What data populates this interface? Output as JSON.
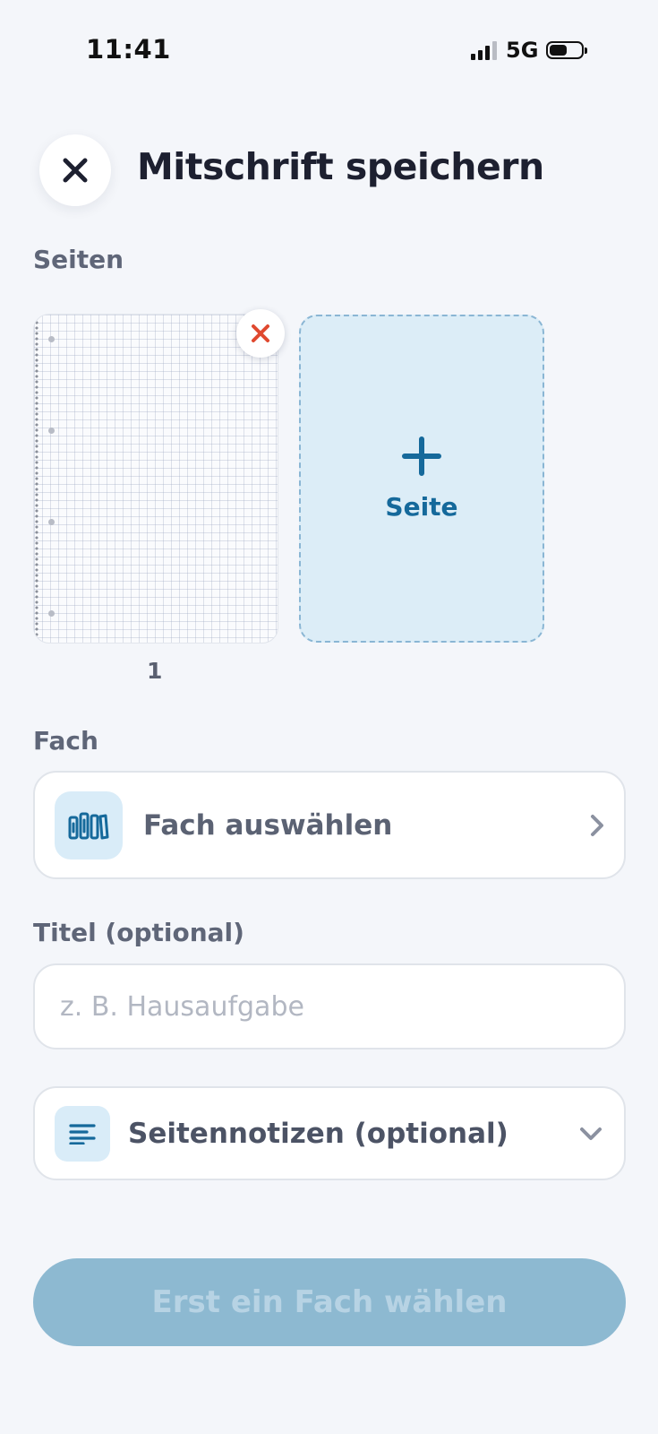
{
  "status_bar": {
    "time": "11:41",
    "network": "5G",
    "signal_bars_active": 3,
    "signal_bars_total": 4,
    "battery_fraction": 0.55
  },
  "header": {
    "close_icon": "close-icon",
    "title": "Mitschrift speichern"
  },
  "pages_section": {
    "label": "Seiten",
    "pages": [
      {
        "number": "1",
        "remove_icon": "remove-x-icon"
      }
    ],
    "add_page": {
      "icon": "plus-icon",
      "label": "Seite"
    }
  },
  "subject_section": {
    "label": "Fach",
    "select_label": "Fach auswählen",
    "icon": "books-icon",
    "chevron_icon": "chevron-right-icon"
  },
  "title_section": {
    "label": "Titel (optional)",
    "value": "",
    "placeholder": "z. B. Hausaufgabe"
  },
  "notes_section": {
    "label": "Seitennotizen (optional)",
    "icon": "text-lines-icon",
    "chevron_icon": "chevron-down-icon"
  },
  "submit": {
    "label": "Erst ein Fach wählen",
    "enabled": false
  },
  "colors": {
    "background": "#f4f6fa",
    "accent": "#15699b",
    "accent_light": "#d9ecf8",
    "remove_red": "#e0492f",
    "disabled_button": "#8db9d1",
    "disabled_button_text": "#b7d3e4"
  }
}
